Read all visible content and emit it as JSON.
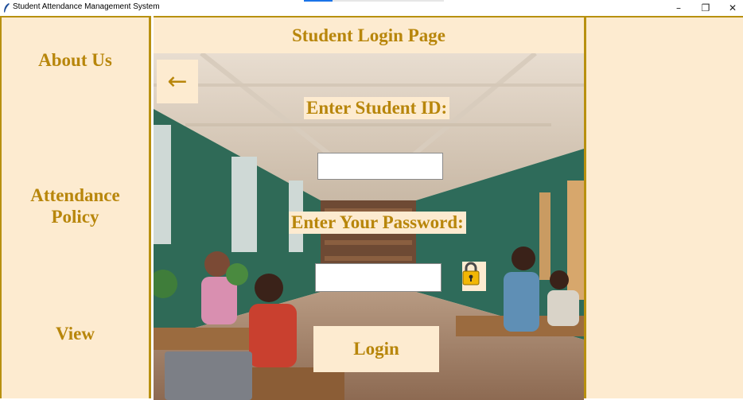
{
  "window": {
    "title": "Student Attendance Management System",
    "controls": {
      "minimize": "–",
      "restore": "❐",
      "close": "✕"
    }
  },
  "sidebar": {
    "items": [
      {
        "label": "About Us"
      },
      {
        "label": "Attendance\nPolicy"
      },
      {
        "label": "View"
      }
    ]
  },
  "main": {
    "title": "Student Login Page",
    "back_glyph": "←",
    "student_id_label": "Enter Student ID:",
    "student_id_value": "",
    "password_label": "Enter Your Password:",
    "password_value": "",
    "login_label": "Login"
  },
  "colors": {
    "panel_bg": "#fdebd0",
    "accent_gold": "#b8860b",
    "border_gold": "#b8900f"
  },
  "icons": [
    "feather-icon",
    "back-arrow-icon",
    "lock-icon"
  ]
}
